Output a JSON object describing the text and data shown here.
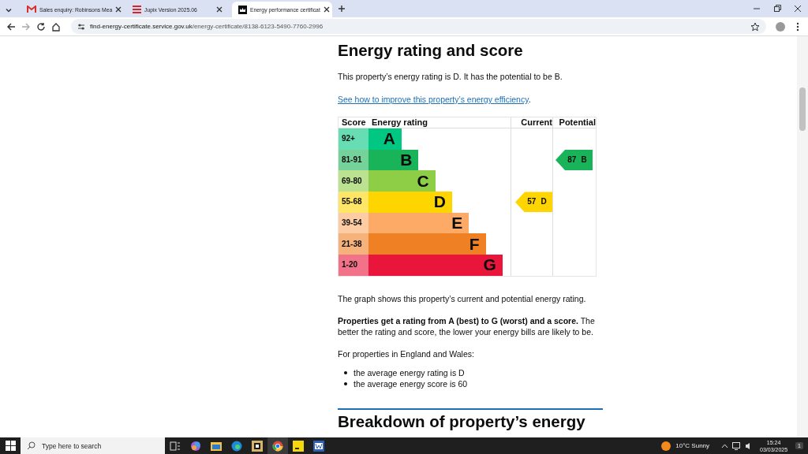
{
  "browser": {
    "tabs": [
      {
        "title": "Sales enquiry: Robinsons Mea",
        "selected": false
      },
      {
        "title": "Jupix Version 2025.06",
        "selected": false
      },
      {
        "title": "Energy performance certificat",
        "selected": true
      }
    ],
    "url_host": "find-energy-certificate.service.gov.uk",
    "url_path": "/energy-certificate/8138-6123-5490-7760-2996"
  },
  "page": {
    "heading": "Energy rating and score",
    "intro": "This property’s energy rating is D. It has the potential to be B.",
    "link": "See how to improve this property’s energy efficiency",
    "link_after": ".",
    "graph": {
      "headers": [
        "Score",
        "Energy rating",
        "Current",
        "Potential"
      ],
      "bands": [
        {
          "score": "92+",
          "letter": "A",
          "color": "#00c781"
        },
        {
          "score": "81-91",
          "letter": "B",
          "color": "#19b459",
          "potential": {
            "score": "87",
            "letter": "B"
          }
        },
        {
          "score": "69-80",
          "letter": "C",
          "color": "#8dce46"
        },
        {
          "score": "55-68",
          "letter": "D",
          "color": "#ffd500",
          "current": {
            "score": "57",
            "letter": "D"
          }
        },
        {
          "score": "39-54",
          "letter": "E",
          "color": "#fcaa65"
        },
        {
          "score": "21-38",
          "letter": "F",
          "color": "#ef8023"
        },
        {
          "score": "1-20",
          "letter": "G",
          "color": "#e9153b"
        }
      ]
    },
    "graph_caption": "The graph shows this property’s current and potential energy rating.",
    "explanation": "**Properties get a rating from A (best) to G (worst) and a score.** The better the rating and score, the lower your energy bills are likely to be.",
    "averages_intro": "For properties in England and Wales:",
    "averages": [
      "the average energy rating is D",
      "the average energy score is 60"
    ],
    "next_heading": "Breakdown of property’s energy"
  },
  "taskbar": {
    "search_placeholder": "Type here to search",
    "weather": "10°C  Sunny",
    "time": "15:24",
    "date": "03/03/2025",
    "notifications": "1"
  }
}
